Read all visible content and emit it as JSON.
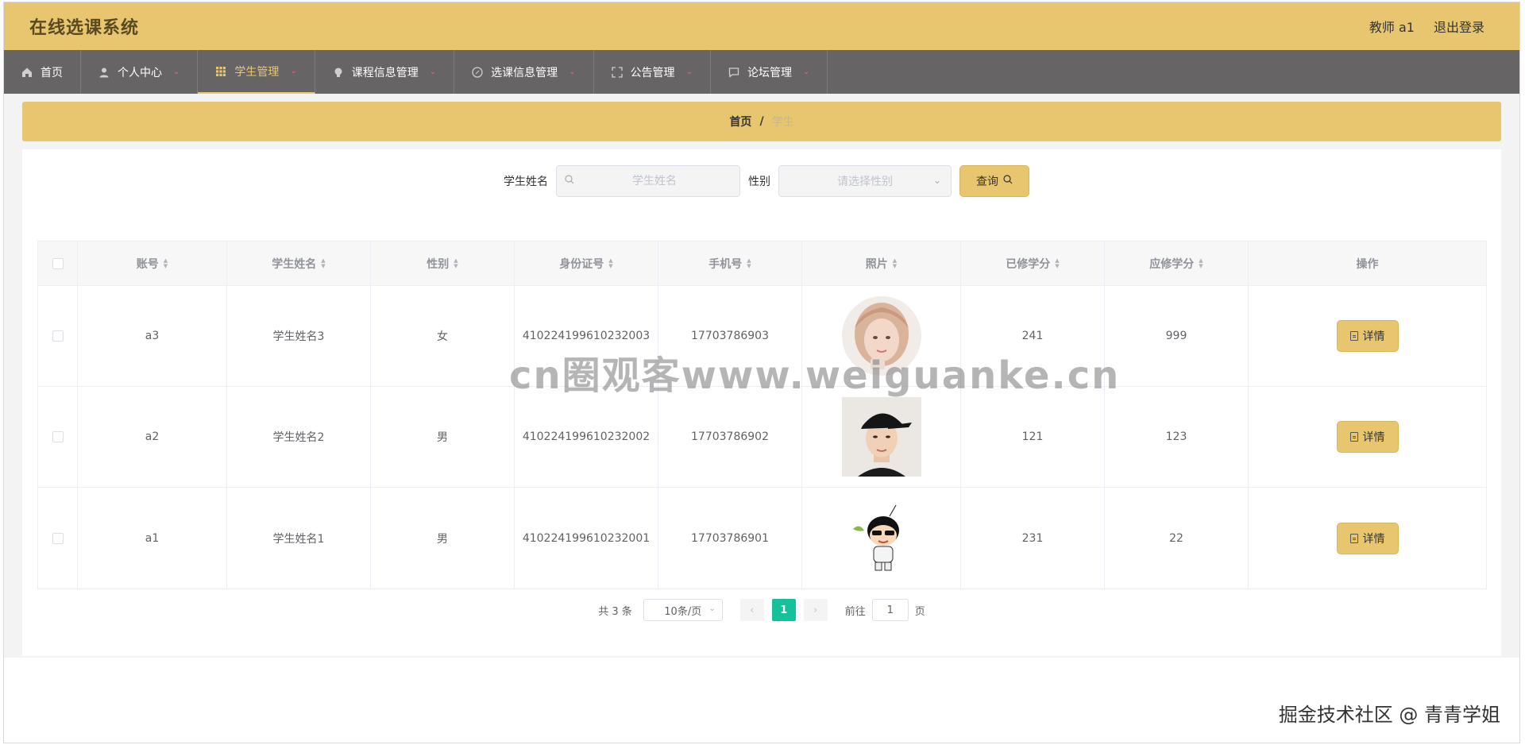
{
  "header": {
    "title": "在线选课系统",
    "user": "教师 a1",
    "logout": "退出登录"
  },
  "nav": [
    {
      "label": "首页",
      "icon": "home-icon",
      "active": false,
      "dropdown": false
    },
    {
      "label": "个人中心",
      "icon": "user-icon",
      "active": false,
      "dropdown": true
    },
    {
      "label": "学生管理",
      "icon": "grid-icon",
      "active": true,
      "dropdown": true
    },
    {
      "label": "课程信息管理",
      "icon": "lightbulb-icon",
      "active": false,
      "dropdown": true
    },
    {
      "label": "选课信息管理",
      "icon": "compass-icon",
      "active": false,
      "dropdown": true
    },
    {
      "label": "公告管理",
      "icon": "fullscreen-icon",
      "active": false,
      "dropdown": true
    },
    {
      "label": "论坛管理",
      "icon": "chat-icon",
      "active": false,
      "dropdown": true
    }
  ],
  "breadcrumb": {
    "home": "首页",
    "sep": "/",
    "current": "学生"
  },
  "search": {
    "name_label": "学生姓名",
    "name_placeholder": "学生姓名",
    "gender_label": "性别",
    "gender_placeholder": "请选择性别",
    "query_label": "查询"
  },
  "table": {
    "headers": [
      "账号",
      "学生姓名",
      "性别",
      "身份证号",
      "手机号",
      "照片",
      "已修学分",
      "应修学分",
      "操作"
    ],
    "rows": [
      {
        "account": "a3",
        "name": "学生姓名3",
        "gender": "女",
        "id_card": "410224199610232003",
        "phone": "17703786903",
        "photo": "girl-portrait",
        "earned": "241",
        "required": "999",
        "action": "详情"
      },
      {
        "account": "a2",
        "name": "学生姓名2",
        "gender": "男",
        "id_card": "410224199610232002",
        "phone": "17703786902",
        "photo": "boy-cap-portrait",
        "earned": "121",
        "required": "123",
        "action": "详情"
      },
      {
        "account": "a1",
        "name": "学生姓名1",
        "gender": "男",
        "id_card": "410224199610232001",
        "phone": "17703786901",
        "photo": "cartoon-boy",
        "earned": "231",
        "required": "22",
        "action": "详情"
      }
    ]
  },
  "pagination": {
    "total": "共 3 条",
    "page_size": "10条/页",
    "current_page": "1",
    "goto_prefix": "前往",
    "goto_value": "1",
    "goto_suffix": "页"
  },
  "watermark": "cn圈观客www.weiguanke.cn",
  "credit": "掘金技术社区 @ 青青学姐",
  "colors": {
    "accent": "#e8c670",
    "nav_bg": "#666464",
    "page_active": "#13c19a",
    "chevron": "#e2687c"
  }
}
